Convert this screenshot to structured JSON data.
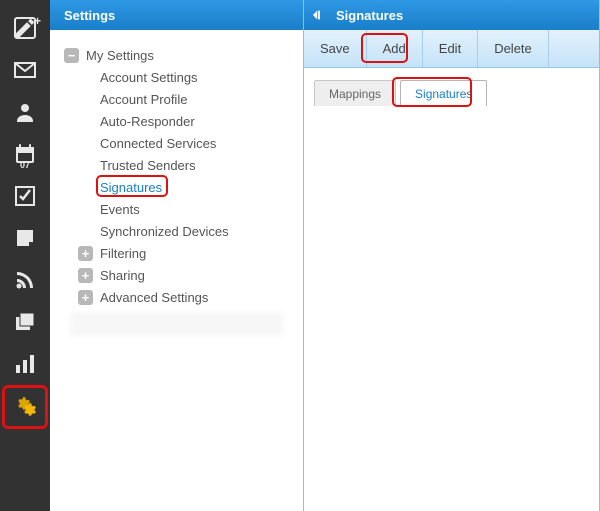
{
  "rail": {
    "calendar_day": "07"
  },
  "settings": {
    "title": "Settings",
    "root": "My Settings",
    "items": [
      "Account Settings",
      "Account Profile",
      "Auto-Responder",
      "Connected Services",
      "Trusted Senders",
      "Signatures",
      "Events",
      "Synchronized Devices"
    ],
    "groups": [
      "Filtering",
      "Sharing",
      "Advanced Settings"
    ]
  },
  "right": {
    "title": "Signatures",
    "toolbar": {
      "save": "Save",
      "add": "Add",
      "edit": "Edit",
      "delete": "Delete"
    },
    "tabs": {
      "mappings": "Mappings",
      "signatures": "Signatures"
    }
  }
}
